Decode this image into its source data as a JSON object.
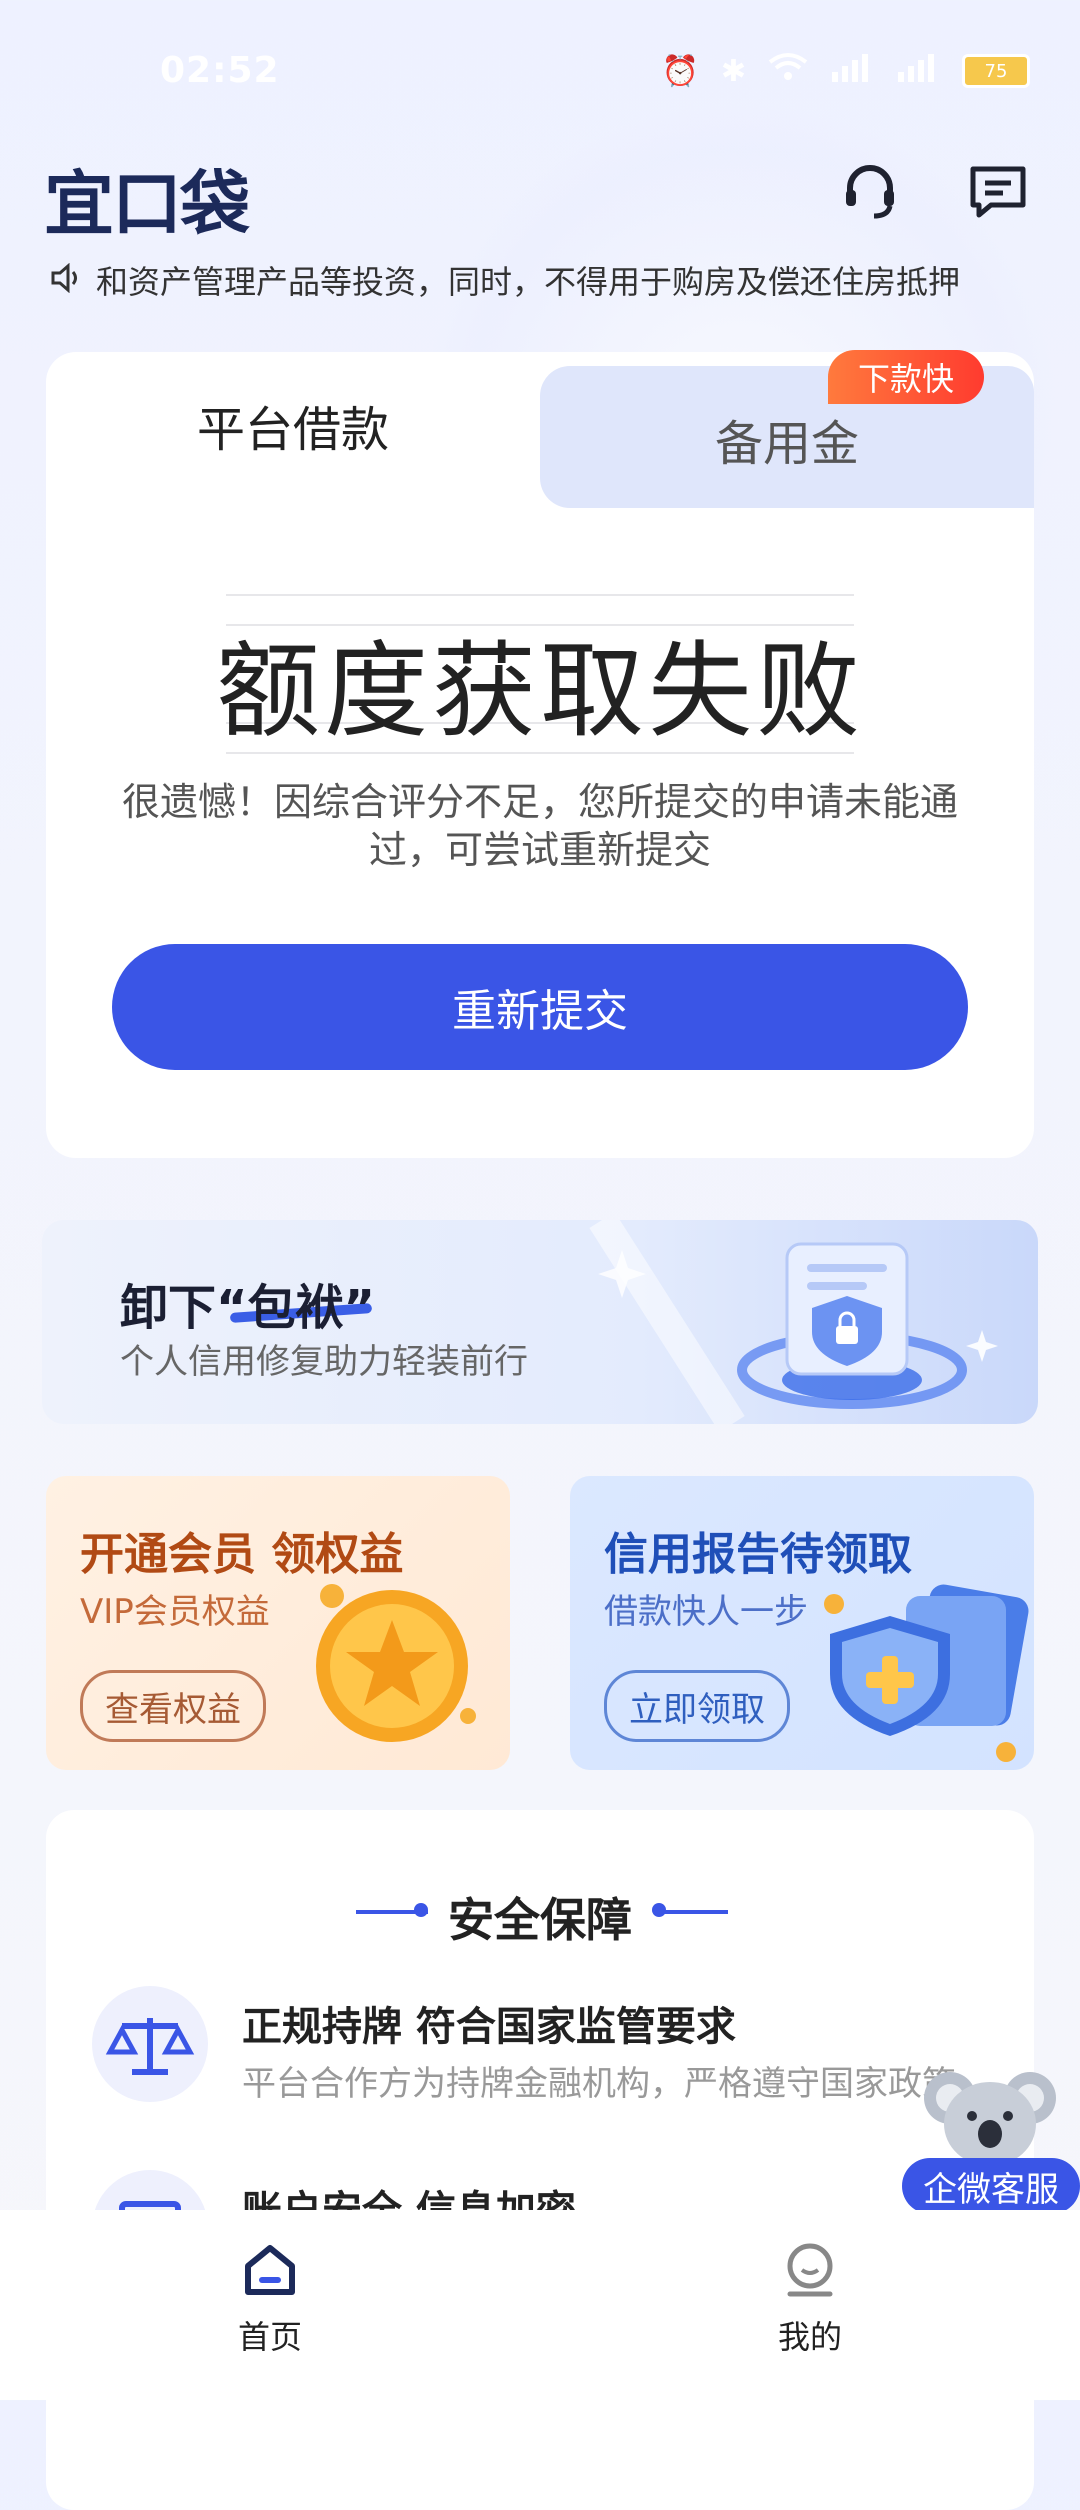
{
  "status_bar": {
    "time": "02:52",
    "battery": "75"
  },
  "header": {
    "logo_text": "宜口袋"
  },
  "notice": {
    "text": "和资产管理产品等投资，同时，不得用于购房及偿还住房抵押"
  },
  "loan_card": {
    "tabs": [
      {
        "label": "平台借款"
      },
      {
        "label": "备用金"
      }
    ],
    "badge": "下款快",
    "result_title": "额度获取失败",
    "result_desc": "很遗憾！因综合评分不足，您所提交的申请未能通过，可尝试重新提交",
    "primary_button": "重新提交"
  },
  "credit_banner": {
    "title": "卸下“包袱”",
    "subtitle": "个人信用修复助力轻装前行"
  },
  "promos": [
    {
      "title": "开通会员 领权益",
      "subtitle": "VIP会员权益",
      "button": "查看权益"
    },
    {
      "title": "信用报告待领取",
      "subtitle": "借款快人一步",
      "button": "立即领取"
    }
  ],
  "security": {
    "title": "安全保障",
    "items": [
      {
        "title": "正规持牌 符合国家监管要求",
        "desc": "平台合作方为持牌金融机构，严格遵守国家政策"
      },
      {
        "title": "账户安全 信息加密",
        "desc": ""
      }
    ]
  },
  "floating_service": {
    "label": "企微客服"
  },
  "bottom_nav": {
    "items": [
      {
        "label": "首页"
      },
      {
        "label": "我的"
      }
    ]
  },
  "colors": {
    "primary": "#3a55e6",
    "badge": "#ff4a33",
    "vip_title": "#b14a14",
    "credit_title": "#1f4fb8"
  }
}
